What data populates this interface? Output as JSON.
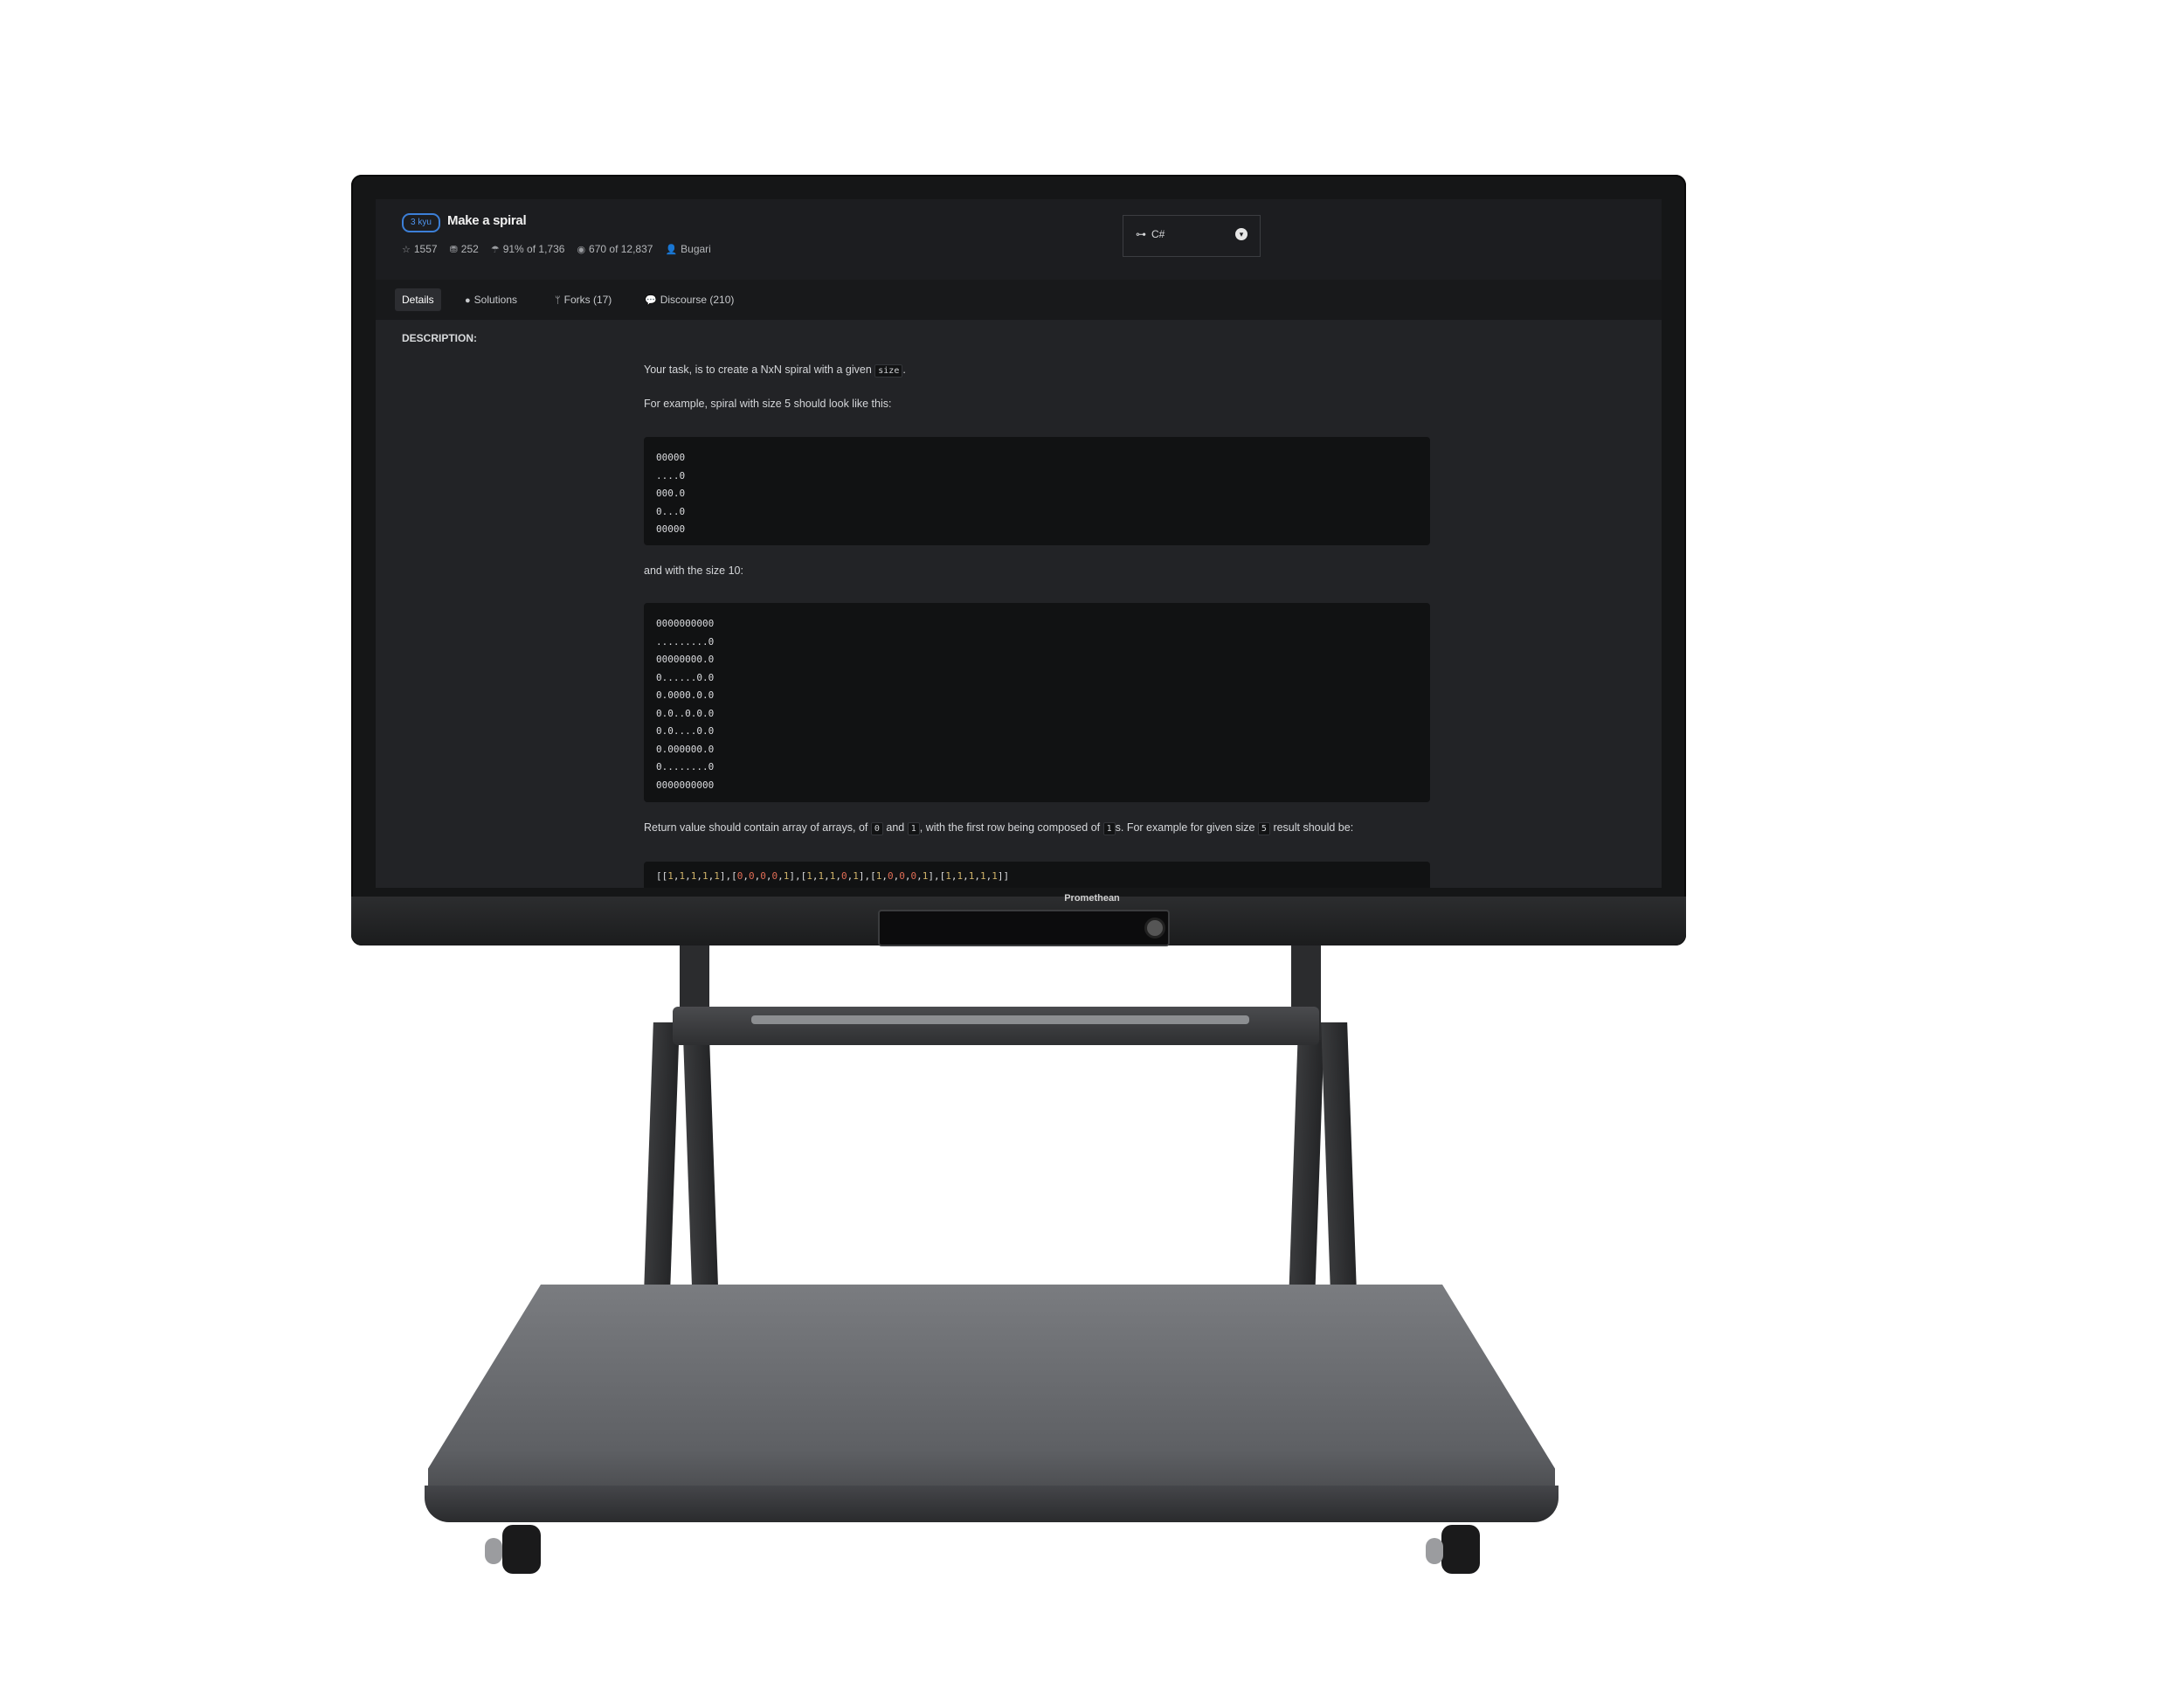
{
  "device": {
    "brand": "Promethean"
  },
  "kata": {
    "rank": "3 kyu",
    "title": "Make a spiral",
    "stats": {
      "stars": "1557",
      "collections": "252",
      "satisfaction": "91% of 1,736",
      "completed": "670 of 12,837",
      "author": "Bugari"
    },
    "language": {
      "label": "C#",
      "icon": "language-icon"
    }
  },
  "tabs": [
    {
      "label": "Details"
    },
    {
      "label": "Solutions"
    },
    {
      "label": "Forks (17)"
    },
    {
      "label": "Discourse (210)"
    }
  ],
  "description": {
    "heading": "DESCRIPTION:",
    "p1_before": "Your task, is to create a NxN spiral with a given",
    "p1_code": "size",
    "p1_after": ".",
    "p2": "For example, spiral with size 5 should look like this:",
    "spiral5": "00000\n....0\n000.0\n0...0\n00000",
    "p3": "and with the size 10:",
    "spiral10": "0000000000\n.........0\n00000000.0\n0......0.0\n0.0000.0.0\n0.0..0.0.0\n0.0....0.0\n0.000000.0\n0........0\n0000000000",
    "p4_a": "Return value should contain array of arrays, of",
    "p4_code0": "0",
    "p4_b": "and",
    "p4_code1": "1",
    "p4_c": ", with the first row being composed of",
    "p4_code2": "1",
    "p4_d": "s. For example for given size",
    "p4_code3": "5",
    "p4_e": "result should be:",
    "result_array": "[[1,1,1,1,1],[0,0,0,0,1],[1,1,1,0,1],[1,0,0,0,1],[1,1,1,1,1]]"
  }
}
